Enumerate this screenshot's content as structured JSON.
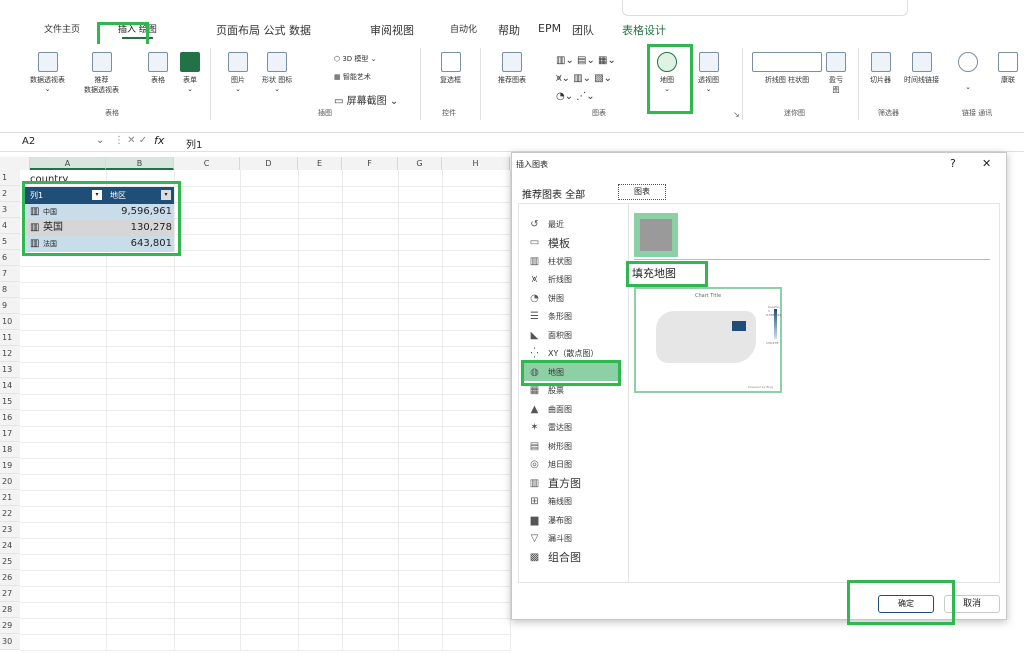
{
  "tabs": [
    "文件主页",
    "插入 绘图",
    "页面布局 公式 数据",
    "审阅视图",
    "自动化",
    "帮助",
    "EPM",
    "团队",
    "表格设计"
  ],
  "ribbon": {
    "pivot": "数据透视表",
    "recommend1": "推荐",
    "recommend2": "数据透视表",
    "table": "表格",
    "form": "表单",
    "picture": "图片",
    "shapes": "形状 图标",
    "model3d": "3D 模型",
    "smartart": "智能艺术",
    "screenshot": "屏幕截图",
    "checkbox": "复选框",
    "recchart": "推荐图表",
    "map": "地图",
    "pivotchart": "透视图",
    "sparklines": "折线图 柱状图",
    "winloss1": "盈亏",
    "winloss2": "图",
    "slicer": "切片器",
    "timeline": "时间线链接",
    "link": "康联",
    "g_table": "表格",
    "g_illus": "插图",
    "g_ctrl": "控件",
    "g_chart": "图表",
    "g_spark": "迷你图",
    "g_filter": "筛选器",
    "g_link": "链接 通讯"
  },
  "formula": {
    "namebox": "A2",
    "fx": "fx",
    "content": "列1"
  },
  "columns": [
    "A",
    "B",
    "C",
    "D",
    "E",
    "F",
    "G",
    "H"
  ],
  "rows": [
    "1",
    "2",
    "3",
    "4",
    "5",
    "6",
    "7",
    "8",
    "9",
    "10",
    "11",
    "12",
    "13",
    "14",
    "15",
    "16",
    "17",
    "18",
    "19",
    "20",
    "21",
    "22",
    "23",
    "24",
    "25",
    "26",
    "27",
    "28",
    "29",
    "30"
  ],
  "sheet": {
    "a1": "country",
    "header": [
      "列1",
      "地区"
    ],
    "data": [
      [
        "中国",
        "9,596,961"
      ],
      [
        "英国",
        "130,278"
      ],
      [
        "法国",
        "643,801"
      ]
    ]
  },
  "dialog": {
    "title": "插入图表",
    "help": "?",
    "close": "✕",
    "tab1": "推荐图表 全部",
    "tab2": "图表",
    "categories": [
      "最近",
      "模板",
      "柱状图",
      "折线图",
      "饼图",
      "条形图",
      "面积图",
      "XY（散点图）",
      "地图",
      "股票",
      "曲面图",
      "雷达图",
      "树形图",
      "旭日图",
      "直方图",
      "箱线图",
      "瀑布图",
      "漏斗图",
      "组合图"
    ],
    "subtype_title": "填充地图",
    "preview": {
      "title": "Chart Title",
      "legend_title": "Column 1",
      "legend_max": "9,596,961",
      "legend_min": "130,278",
      "credit": "Powered by Bing"
    },
    "ok": "确定",
    "cancel": "取消"
  },
  "accent": "#217346",
  "highlight": "#2eb84f"
}
